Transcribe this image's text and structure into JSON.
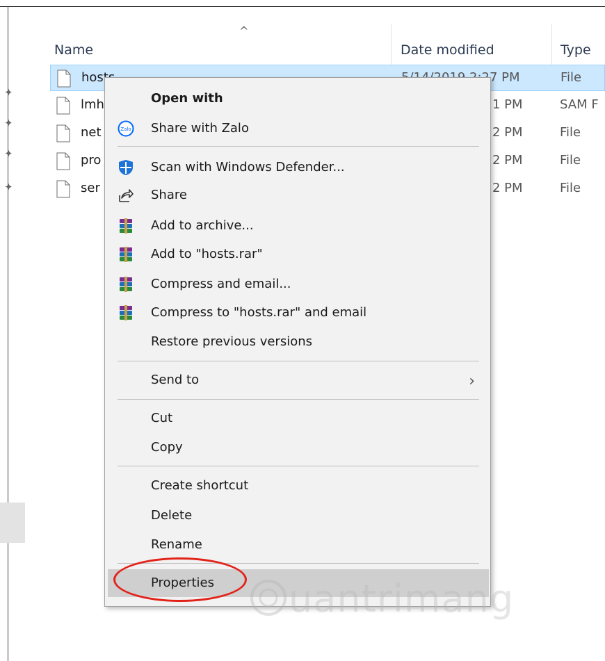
{
  "columns": {
    "name": "Name",
    "date_modified": "Date modified",
    "type": "Type"
  },
  "files": [
    {
      "name": "hosts",
      "date": "5/14/2019 2:27 PM",
      "type": "File",
      "selected": true
    },
    {
      "name": "lmh",
      "date": "1 PM",
      "type": "SAM F",
      "selected": false
    },
    {
      "name": "net",
      "date": "2 PM",
      "type": "File",
      "selected": false
    },
    {
      "name": "pro",
      "date": "2 PM",
      "type": "File",
      "selected": false
    },
    {
      "name": "ser",
      "date": "2 PM",
      "type": "File",
      "selected": false
    }
  ],
  "context_menu": {
    "open_with": "Open with",
    "share_with_zalo": "Share with Zalo",
    "scan_defender": "Scan with Windows Defender...",
    "share": "Share",
    "add_to_archive": "Add to archive...",
    "add_to_rar": "Add to \"hosts.rar\"",
    "compress_email": "Compress and email...",
    "compress_rar_email": "Compress to \"hosts.rar\" and email",
    "restore_versions": "Restore previous versions",
    "send_to": "Send to",
    "cut": "Cut",
    "copy": "Copy",
    "create_shortcut": "Create shortcut",
    "delete": "Delete",
    "rename": "Rename",
    "properties": "Properties"
  },
  "watermark": "uantrimang",
  "colors": {
    "selection": "#cce8ff",
    "highlight_circle": "#e2231a",
    "defender_blue": "#1e73d8",
    "zalo_blue": "#0068ff"
  }
}
